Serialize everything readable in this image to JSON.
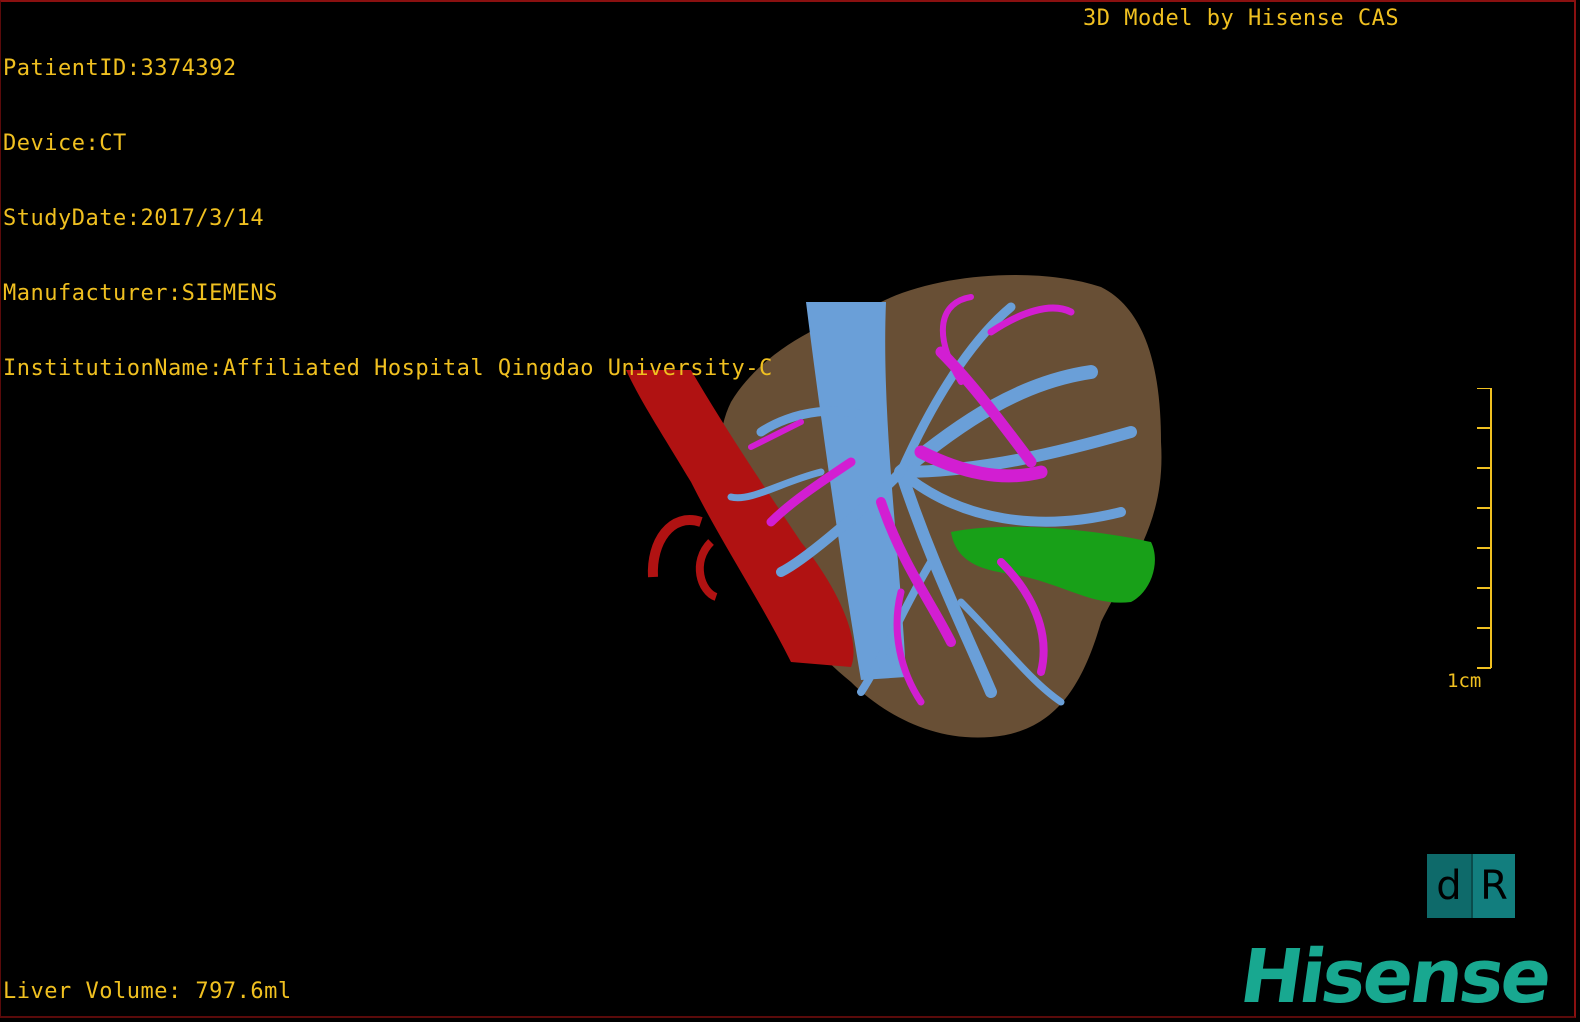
{
  "patient_info": {
    "patient_id": "PatientID:3374392",
    "device": "Device:CT",
    "study_date": "StudyDate:2017/3/14",
    "manufacturer": "Manufacturer:SIEMENS",
    "institution": "InstitutionName:Affiliated Hospital Qingdao University-C"
  },
  "model_credit": "3D Model by Hisense CAS",
  "liver_volume": "Liver Volume: 797.6ml",
  "scale": {
    "label": "1cm",
    "ticks": 8
  },
  "orientation_cube": {
    "left_face": "d",
    "right_face": "R"
  },
  "brand": "Hisense",
  "colors": {
    "overlay_text": "#f0c020",
    "liver": "#7a5d3e",
    "portal_vein": "#6a9fd8",
    "hepatic_vein": "#d21ed2",
    "artery": "#c01010",
    "gallbladder": "#1aa81a",
    "brand": "#18a890"
  }
}
